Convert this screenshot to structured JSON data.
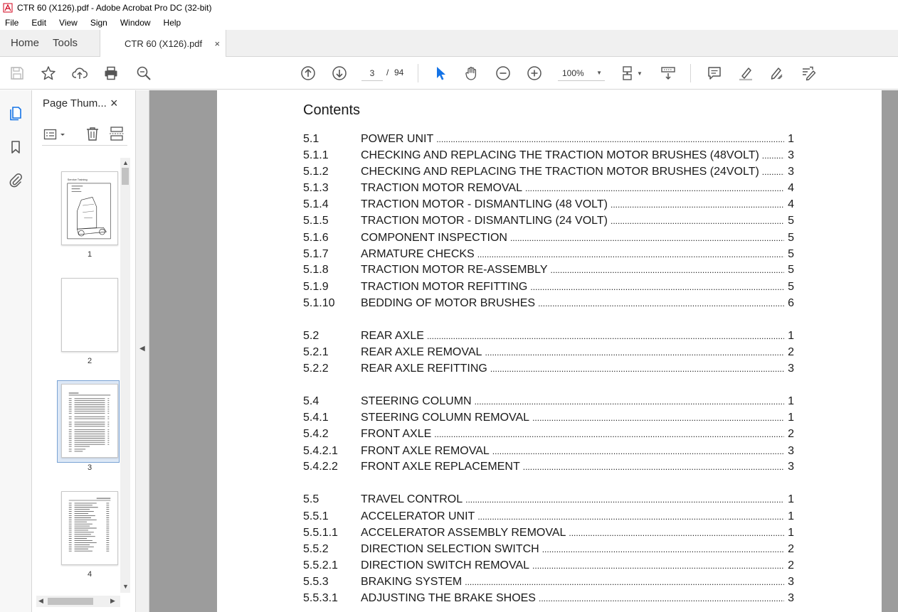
{
  "window": {
    "title": "CTR 60 (X126).pdf - Adobe Acrobat Pro DC (32-bit)"
  },
  "menu": [
    "File",
    "Edit",
    "View",
    "Sign",
    "Window",
    "Help"
  ],
  "tabs": {
    "home": "Home",
    "tools": "Tools",
    "document": "CTR 60 (X126).pdf",
    "close": "×"
  },
  "toolbar": {
    "page_current": "3",
    "page_sep": "/",
    "page_total": "94",
    "zoom": "100%",
    "accent": "#1473e6"
  },
  "thumbnails": {
    "header": "Page Thum...",
    "close": "×",
    "pages": [
      {
        "label": "1"
      },
      {
        "label": "2"
      },
      {
        "label": "3",
        "selected": true
      },
      {
        "label": "4"
      }
    ]
  },
  "document": {
    "heading": "Contents",
    "toc": [
      {
        "num": "5.1",
        "title": "POWER UNIT",
        "page": "1"
      },
      {
        "num": "5.1.1",
        "title": "CHECKING AND REPLACING THE TRACTION MOTOR BRUSHES (48VOLT)",
        "page": "3"
      },
      {
        "num": "5.1.2",
        "title": "CHECKING AND REPLACING THE TRACTION MOTOR BRUSHES (24VOLT)",
        "page": "3"
      },
      {
        "num": "5.1.3",
        "title": "TRACTION MOTOR REMOVAL",
        "page": "4"
      },
      {
        "num": "5.1.4",
        "title": "TRACTION MOTOR - DISMANTLING (48 VOLT)",
        "page": "4"
      },
      {
        "num": "5.1.5",
        "title": "TRACTION MOTOR - DISMANTLING (24 VOLT)",
        "page": "5"
      },
      {
        "num": "5.1.6",
        "title": "COMPONENT INSPECTION",
        "page": "5"
      },
      {
        "num": "5.1.7",
        "title": "ARMATURE CHECKS",
        "page": "5"
      },
      {
        "num": "5.1.8",
        "title": "TRACTION MOTOR RE-ASSEMBLY",
        "page": "5"
      },
      {
        "num": "5.1.9",
        "title": "TRACTION MOTOR REFITTING",
        "page": "5"
      },
      {
        "num": "5.1.10",
        "title": "BEDDING OF MOTOR BRUSHES",
        "page": "6"
      },
      {
        "num": "5.2",
        "title": "REAR AXLE",
        "page": "1"
      },
      {
        "num": "5.2.1",
        "title": "REAR AXLE REMOVAL",
        "page": "2"
      },
      {
        "num": "5.2.2",
        "title": "REAR AXLE REFITTING",
        "page": "3"
      },
      {
        "num": "5.4",
        "title": "STEERING COLUMN",
        "page": "1"
      },
      {
        "num": "5.4.1",
        "title": "STEERING COLUMN REMOVAL",
        "page": "1"
      },
      {
        "num": "5.4.2",
        "title": "FRONT AXLE",
        "page": "2"
      },
      {
        "num": "5.4.2.1",
        "title": "FRONT AXLE REMOVAL",
        "page": "3"
      },
      {
        "num": "5.4.2.2",
        "title": "FRONT AXLE REPLACEMENT",
        "page": "3"
      },
      {
        "num": "5.5",
        "title": "TRAVEL CONTROL",
        "page": "1"
      },
      {
        "num": "5.5.1",
        "title": "ACCELERATOR UNIT",
        "page": "1"
      },
      {
        "num": "5.5.1.1",
        "title": "ACCELERATOR ASSEMBLY REMOVAL",
        "page": "1"
      },
      {
        "num": "5.5.2",
        "title": "DIRECTION SELECTION SWITCH",
        "page": "2"
      },
      {
        "num": "5.5.2.1",
        "title": "DIRECTION SWITCH REMOVAL",
        "page": "2"
      },
      {
        "num": "5.5.3",
        "title": "BRAKING SYSTEM",
        "page": "3"
      },
      {
        "num": "5.5.3.1",
        "title": "ADJUSTING THE BRAKE SHOES",
        "page": "3"
      }
    ]
  }
}
